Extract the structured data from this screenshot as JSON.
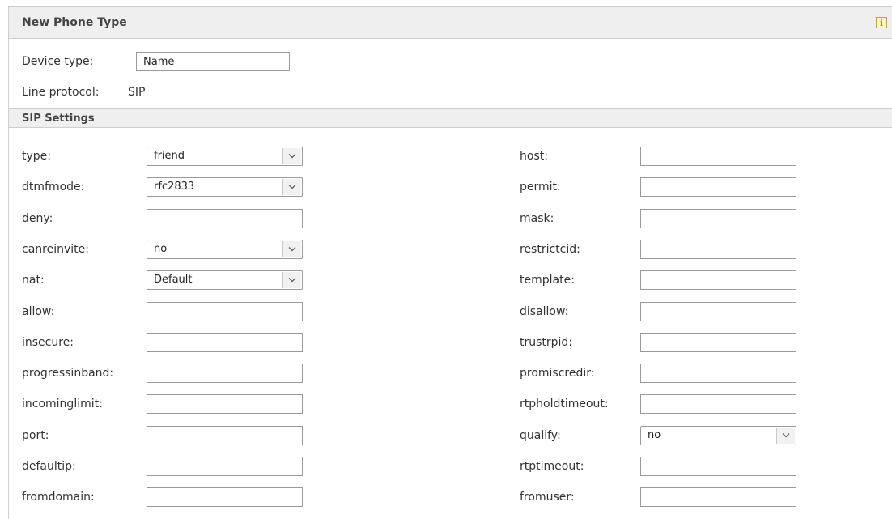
{
  "panel": {
    "title": "New Phone Type",
    "info_icon": "info-icon",
    "device_type": {
      "label": "Device type:",
      "value": "Name"
    },
    "line_protocol": {
      "label": "Line protocol:",
      "value": "SIP"
    }
  },
  "sip": {
    "title": "SIP Settings",
    "left": [
      {
        "label": "type:",
        "kind": "select",
        "value": "friend"
      },
      {
        "label": "dtmfmode:",
        "kind": "select",
        "value": "rfc2833"
      },
      {
        "label": "deny:",
        "kind": "text",
        "value": ""
      },
      {
        "label": "canreinvite:",
        "kind": "select",
        "value": "no"
      },
      {
        "label": "nat:",
        "kind": "select",
        "value": "Default"
      },
      {
        "label": "allow:",
        "kind": "text",
        "value": ""
      },
      {
        "label": "insecure:",
        "kind": "text",
        "value": ""
      },
      {
        "label": "progressinband:",
        "kind": "text",
        "value": ""
      },
      {
        "label": "incominglimit:",
        "kind": "text",
        "value": ""
      },
      {
        "label": "port:",
        "kind": "text",
        "value": ""
      },
      {
        "label": "defaultip:",
        "kind": "text",
        "value": ""
      },
      {
        "label": "fromdomain:",
        "kind": "text",
        "value": ""
      }
    ],
    "right": [
      {
        "label": "host:",
        "kind": "text",
        "value": ""
      },
      {
        "label": "permit:",
        "kind": "text",
        "value": ""
      },
      {
        "label": "mask:",
        "kind": "text",
        "value": ""
      },
      {
        "label": "restrictcid:",
        "kind": "text",
        "value": ""
      },
      {
        "label": "template:",
        "kind": "text",
        "value": ""
      },
      {
        "label": "disallow:",
        "kind": "text",
        "value": ""
      },
      {
        "label": "trustrpid:",
        "kind": "text",
        "value": ""
      },
      {
        "label": "promiscredir:",
        "kind": "text",
        "value": ""
      },
      {
        "label": "rtpholdtimeout:",
        "kind": "text",
        "value": ""
      },
      {
        "label": "qualify:",
        "kind": "select",
        "value": "no"
      },
      {
        "label": "rtptimeout:",
        "kind": "text",
        "value": ""
      },
      {
        "label": "fromuser:",
        "kind": "text",
        "value": ""
      }
    ]
  }
}
